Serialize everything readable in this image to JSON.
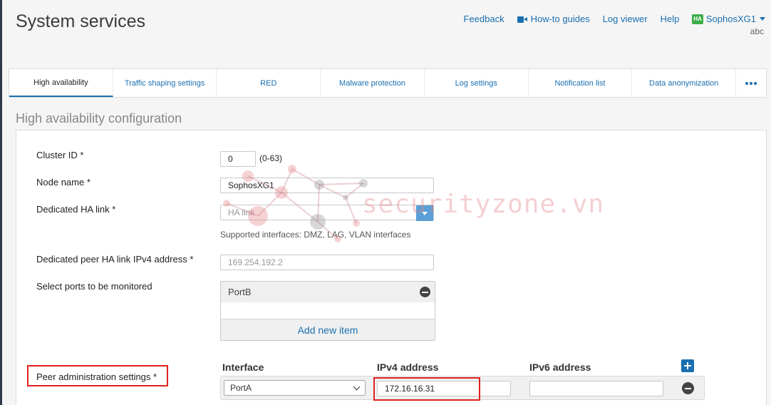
{
  "header": {
    "title": "System services",
    "links": {
      "feedback": "Feedback",
      "how_to": "How-to guides",
      "log_viewer": "Log viewer",
      "help": "Help"
    },
    "user": {
      "badge": "HA",
      "name": "SophosXG1",
      "sub": "abc"
    }
  },
  "tabs": [
    {
      "label": "High availability",
      "active": true
    },
    {
      "label": "Traffic shaping settings"
    },
    {
      "label": "RED"
    },
    {
      "label": "Malware protection"
    },
    {
      "label": "Log settings"
    },
    {
      "label": "Notification list"
    },
    {
      "label": "Data anonymization"
    }
  ],
  "section": {
    "title": "High availability configuration",
    "cluster_id": {
      "label": "Cluster ID *",
      "value": "0",
      "range": "(0-63)"
    },
    "node_name": {
      "label": "Node name *",
      "value": "SophosXG1"
    },
    "ha_link": {
      "label": "Dedicated HA link *",
      "placeholder": "HA link",
      "hint": "Supported interfaces: DMZ, LAG, VLAN interfaces"
    },
    "peer_ha_ip": {
      "label": "Dedicated peer HA link IPv4 address *",
      "value": "169.254.192.2"
    },
    "ports": {
      "label": "Select ports to be monitored",
      "items": [
        "PortB"
      ],
      "add_label": "Add new item"
    },
    "peer_admin": {
      "label": "Peer administration settings *",
      "columns": {
        "interface": "Interface",
        "ipv4": "IPv4 address",
        "ipv6": "IPv6 address"
      },
      "row": {
        "interface": "PortA",
        "ipv4": "172.16.16.31",
        "ipv6": ""
      }
    }
  },
  "watermark": "securityzone.vn",
  "colors": {
    "accent": "#1a6fb0",
    "ha_badge": "#3fae49",
    "highlight": "#e02020",
    "dropdown": "#5a9fd6"
  }
}
